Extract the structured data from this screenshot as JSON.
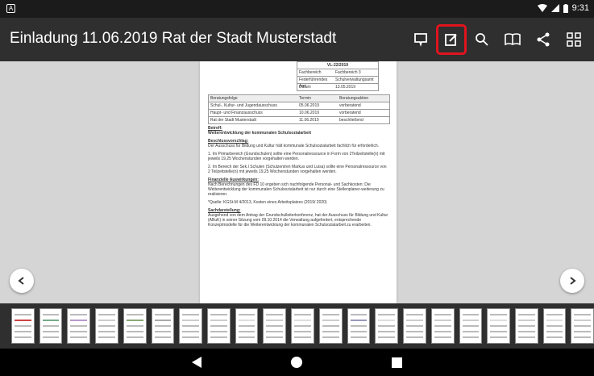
{
  "statusbar": {
    "time": "9:31"
  },
  "appbar": {
    "title": "Einladung 11.06.2019 Rat der Stadt Musterstadt",
    "icons": [
      "comment-icon",
      "edit-icon",
      "search-icon",
      "book-icon",
      "share-icon",
      "grid-icon"
    ]
  },
  "document": {
    "ref": "VL-22/2019",
    "meta": [
      [
        "Fachbereich",
        "Fachbereich 3"
      ],
      [
        "Federführendes Amt",
        "Schulverwaltungsamt"
      ],
      [
        "Datum",
        "13.05.2019"
      ]
    ],
    "table_headers": [
      "Beratungsfolge",
      "Termin",
      "Beratungsaktion"
    ],
    "table_rows": [
      [
        "Schul-, Kultur- und Jugendausschuss",
        "05.06.2019",
        "vorberatend"
      ],
      [
        "Haupt- und Finanzausschuss",
        "10.06.2019",
        "vorberatend"
      ],
      [
        "Rat der Stadt Musterstadt",
        "11.06.2019",
        "beschließend"
      ]
    ],
    "betreff_label": "Betreff:",
    "betreff": "Weiterentwicklung der kommunalen Schulsozialarbeit",
    "beschluss_label": "Beschlussvorschlag:",
    "beschluss": "Der Ausschuss für Bildung und Kultur hält kommunale Schulsozialarbeit fachlich für erforderlich.",
    "p1": "1. Im Primarbereich (Grundschulen) sollte eine Personalressource in Form von 2Teilzeitstelle(n) mit jeweils 19,25 Wochenstunden vorgehalten werden.",
    "p2": "2. Im Bereich der Sek.I Schulen (Schulzentren Markus und Luisa) sollte eine Personalressource von 2 Teilzeitstelle(n) mit jeweils 19,25 Wochenstunden vorgehalten werden.",
    "finanz_label": "Finanzielle Auswirkungen:",
    "finanz": "Nach Berechnungen des FD 10 ergeben sich nachfolgende Personal- und Sachkosten: Die Weiterentwicklung der kommunalen Schulsozialarbeit ist nur durch eine Stellenplaner-weiterung zu realisieren.",
    "quelle": "*Quelle: KGSt-M 4/2013, Kosten eines Arbeitsplatzes (2019/ 2020)",
    "sach_label": "Sachdarstellung:",
    "sach": "Ausgehend von dem Antrag der Grundschulleiterkonferenz, hat der Ausschuss für Bildung und Kultur (ABuK) in seiner Sitzung vom 09.10.2014 die Verwaltung aufgefordert, entsprechende Konzeptmodelle für die Weiterentwicklung der kommunalen Schulsozialarbeit zu erarbeiten."
  },
  "thumbnails": {
    "count": 21
  },
  "colors": {
    "highlight": "#e0141e",
    "appbar": "#2f2f2f",
    "background": "#d5d5d5"
  }
}
